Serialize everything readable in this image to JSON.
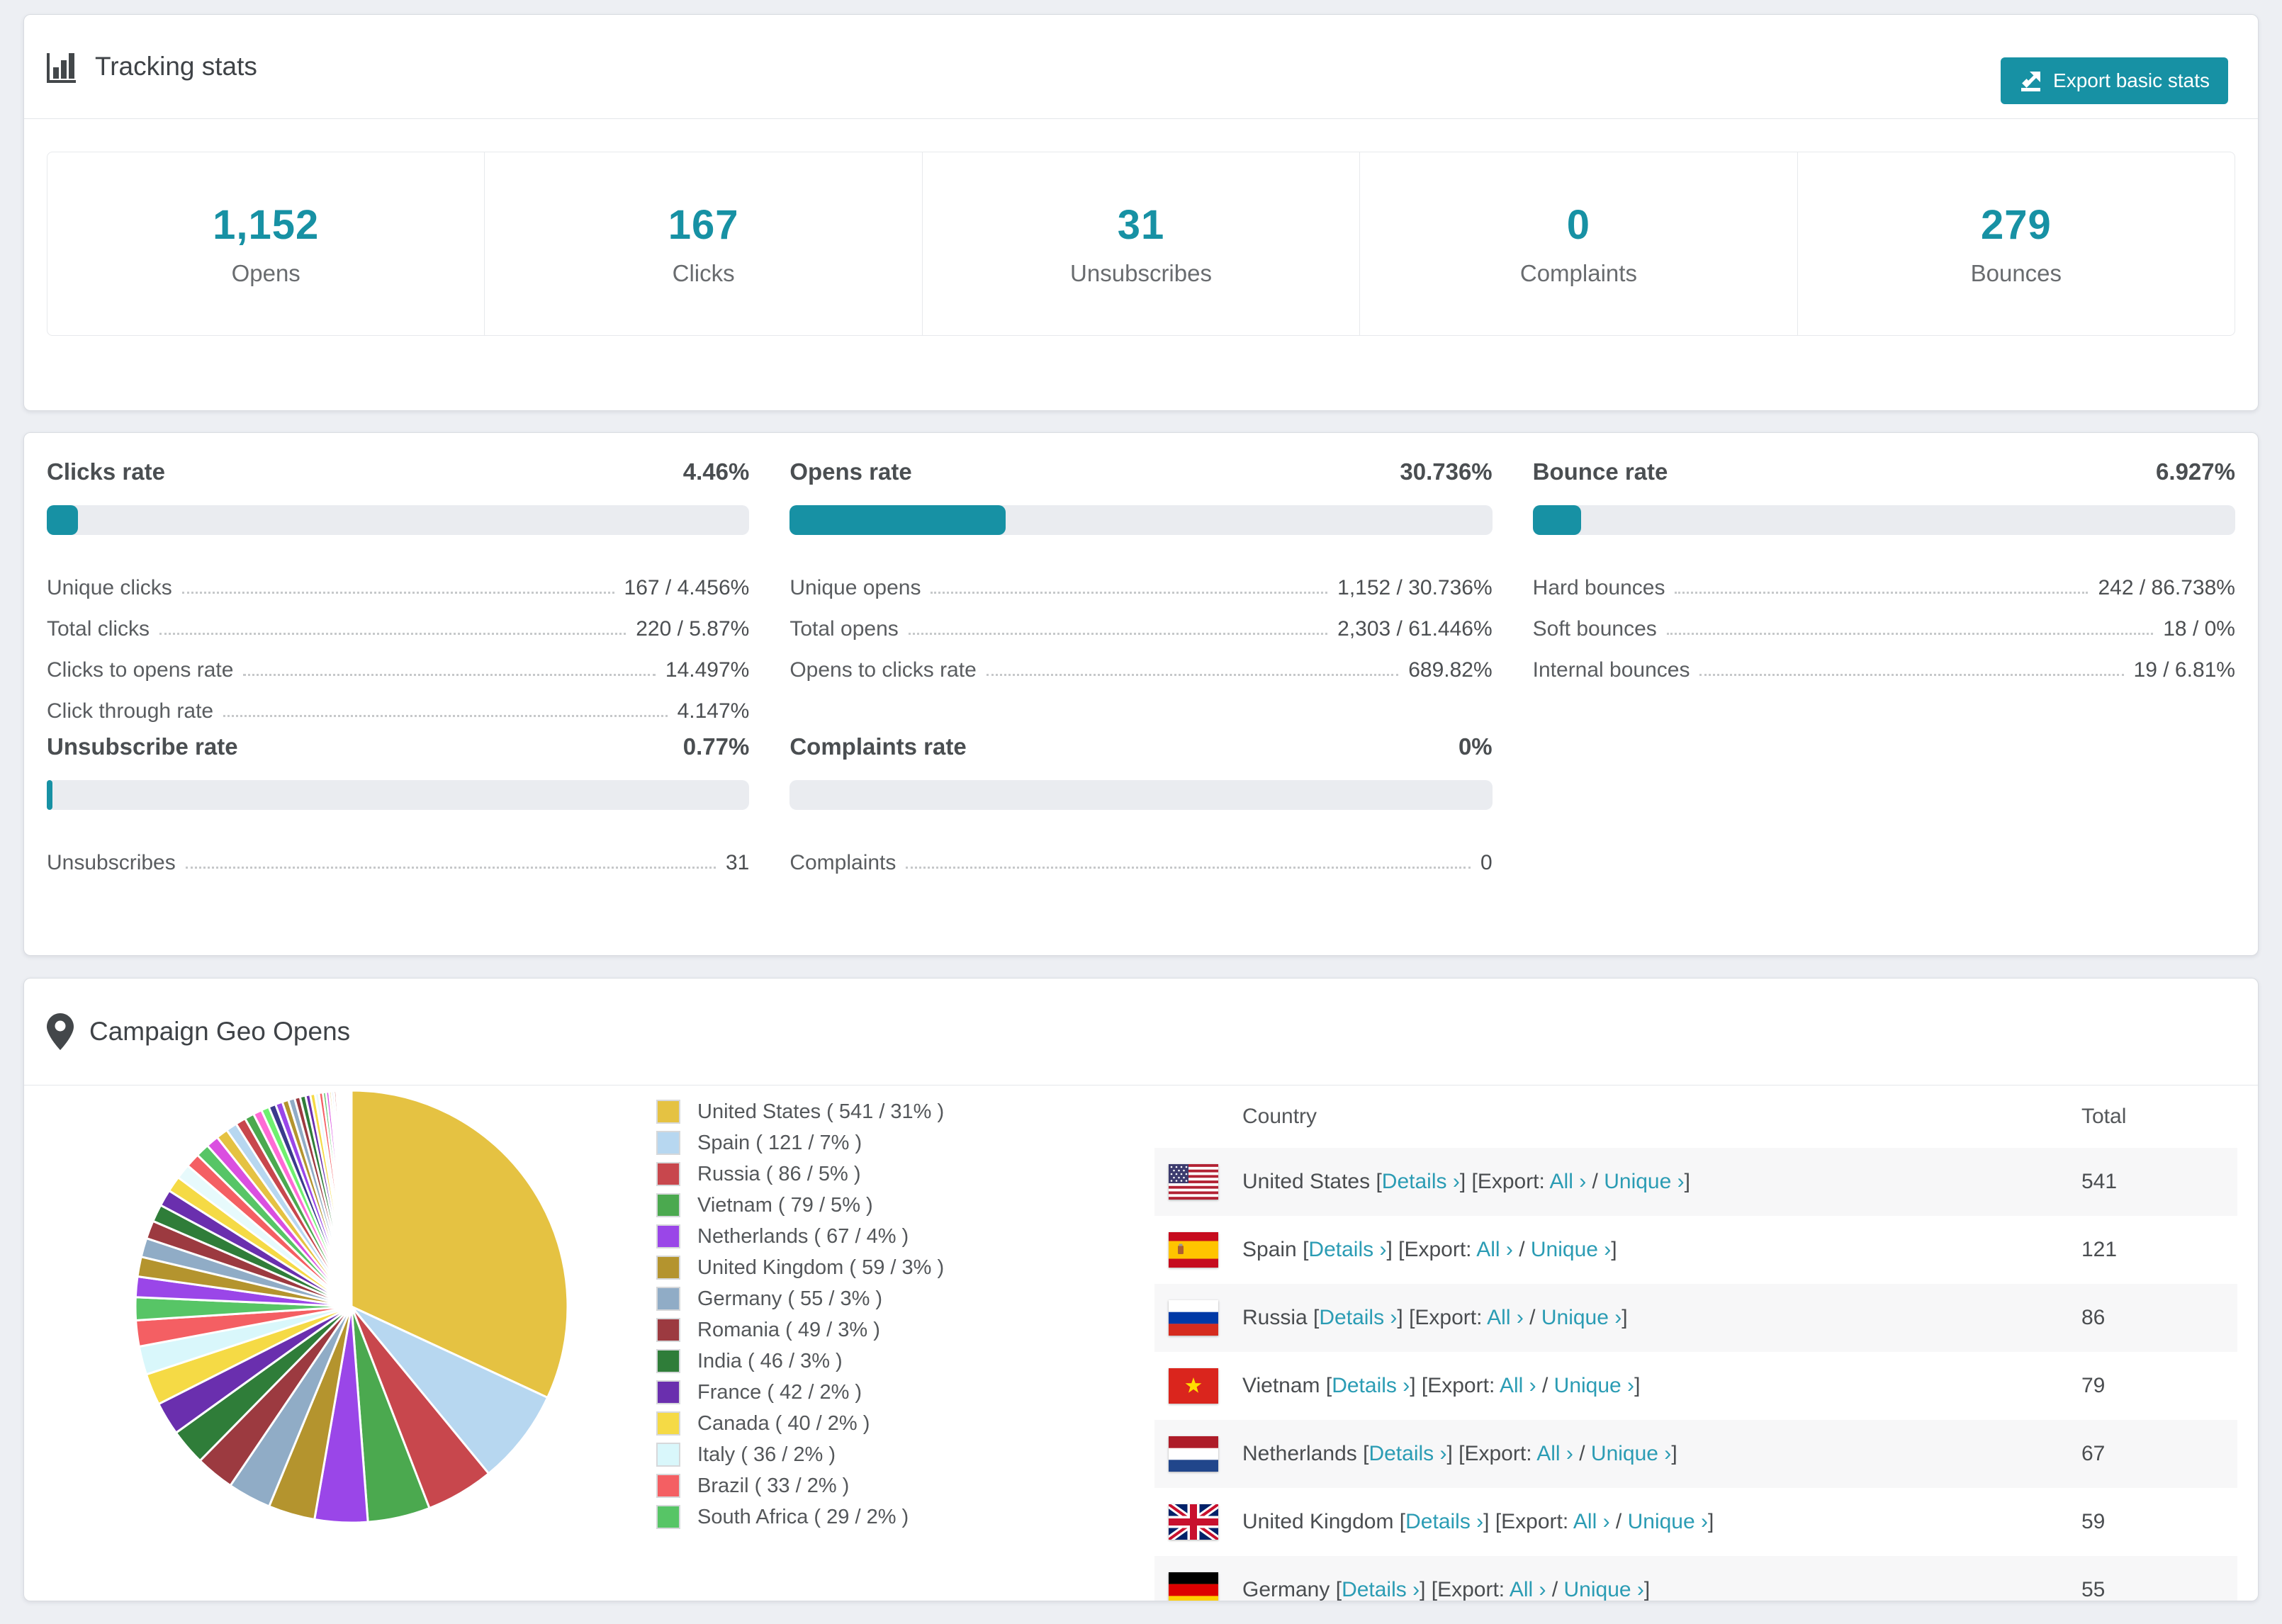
{
  "colors": {
    "accent_teal": "#1791a4",
    "link_teal": "#2b9cb4",
    "page_background": "#edeff3"
  },
  "tracking": {
    "title": "Tracking stats",
    "export_button": "Export basic stats",
    "stats": [
      {
        "value": "1,152",
        "label": "Opens"
      },
      {
        "value": "167",
        "label": "Clicks"
      },
      {
        "value": "31",
        "label": "Unsubscribes"
      },
      {
        "value": "0",
        "label": "Complaints"
      },
      {
        "value": "279",
        "label": "Bounces"
      }
    ]
  },
  "rates": {
    "sections": [
      {
        "id": "clicks",
        "title": "Clicks rate",
        "value": "4.46%",
        "pct": 4.46,
        "rows": [
          {
            "label": "Unique clicks",
            "value": "167 / 4.456%"
          },
          {
            "label": "Total clicks",
            "value": "220 / 5.87%"
          },
          {
            "label": "Clicks to opens rate",
            "value": "14.497%"
          },
          {
            "label": "Click through rate",
            "value": "4.147%"
          }
        ]
      },
      {
        "id": "opens",
        "title": "Opens rate",
        "value": "30.736%",
        "pct": 30.736,
        "rows": [
          {
            "label": "Unique opens",
            "value": "1,152 / 30.736%"
          },
          {
            "label": "Total opens",
            "value": "2,303 / 61.446%"
          },
          {
            "label": "Opens to clicks rate",
            "value": "689.82%"
          }
        ]
      },
      {
        "id": "bounce",
        "title": "Bounce rate",
        "value": "6.927%",
        "pct": 6.927,
        "rows": [
          {
            "label": "Hard bounces",
            "value": "242 / 86.738%"
          },
          {
            "label": "Soft bounces",
            "value": "18 / 0%"
          },
          {
            "label": "Internal bounces",
            "value": "19 / 6.81%"
          }
        ]
      },
      {
        "id": "unsubscribe",
        "title": "Unsubscribe rate",
        "value": "0.77%",
        "pct": 0.77,
        "rows": [
          {
            "label": "Unsubscribes",
            "value": "31"
          }
        ]
      },
      {
        "id": "complaints",
        "title": "Complaints rate",
        "value": "0%",
        "pct": 0,
        "rows": [
          {
            "label": "Complaints",
            "value": "0"
          }
        ]
      }
    ]
  },
  "geo": {
    "title": "Campaign Geo Opens",
    "table": {
      "columns": [
        "Country",
        "Total"
      ],
      "details_open": "[",
      "details_label": "Details ›",
      "details_close": "]",
      "export_prefix": "[Export:",
      "all_label": "All ›",
      "separator": "/",
      "unique_label": "Unique ›",
      "close_bracket": "]",
      "rows": [
        {
          "country": "United States",
          "flag": "us",
          "total": "541"
        },
        {
          "country": "Spain",
          "flag": "es",
          "total": "121"
        },
        {
          "country": "Russia",
          "flag": "ru",
          "total": "86"
        },
        {
          "country": "Vietnam",
          "flag": "vn",
          "total": "79"
        },
        {
          "country": "Netherlands",
          "flag": "nl",
          "total": "67"
        },
        {
          "country": "United Kingdom",
          "flag": "gb",
          "total": "59"
        },
        {
          "country": "Germany",
          "flag": "de",
          "total": "55"
        }
      ]
    },
    "chart_data": {
      "type": "pie",
      "title": "Campaign Geo Opens",
      "legend_position": "right",
      "series": [
        {
          "name": "United States",
          "value": 541,
          "pct": "31%"
        },
        {
          "name": "Spain",
          "value": 121,
          "pct": "7%"
        },
        {
          "name": "Russia",
          "value": 86,
          "pct": "5%"
        },
        {
          "name": "Vietnam",
          "value": 79,
          "pct": "5%"
        },
        {
          "name": "Netherlands",
          "value": 67,
          "pct": "4%"
        },
        {
          "name": "United Kingdom",
          "value": 59,
          "pct": "3%"
        },
        {
          "name": "Germany",
          "value": 55,
          "pct": "3%"
        },
        {
          "name": "Romania",
          "value": 49,
          "pct": "3%"
        },
        {
          "name": "India",
          "value": 46,
          "pct": "3%"
        },
        {
          "name": "France",
          "value": 42,
          "pct": "2%"
        },
        {
          "name": "Canada",
          "value": 40,
          "pct": "2%"
        },
        {
          "name": "Italy",
          "value": 36,
          "pct": "2%"
        },
        {
          "name": "Brazil",
          "value": 33,
          "pct": "2%"
        },
        {
          "name": "South Africa",
          "value": 29,
          "pct": "2%"
        }
      ],
      "others_estimated_values": [
        26,
        25,
        24,
        23,
        22,
        21,
        20,
        19,
        18,
        17,
        16,
        15,
        14,
        13,
        12,
        11,
        10,
        9,
        9,
        8,
        8,
        7,
        7,
        6,
        6,
        5,
        5,
        4,
        4,
        3,
        3,
        3,
        2,
        2,
        2,
        2,
        2,
        1,
        1,
        1,
        1,
        1,
        1,
        1,
        1,
        1
      ],
      "palette": [
        "#e5c242",
        "#b7d7f0",
        "#c8474d",
        "#4ba94f",
        "#9a46e8",
        "#b4942e",
        "#90acc6",
        "#9c3a40",
        "#2f7d39",
        "#6a2fae",
        "#f5da45",
        "#d9f7fb",
        "#f45f63",
        "#57c566"
      ],
      "others_palette": [
        "#9a46e8",
        "#b4942e",
        "#90acc6",
        "#9c3a40",
        "#2f7d39",
        "#6a2fae",
        "#f5da45",
        "#e7fafc",
        "#f45f63",
        "#57c566",
        "#da4fe0",
        "#e5c242",
        "#b7d7f0",
        "#c8474d",
        "#4ba94f",
        "#ff6ad5",
        "#6ff06f",
        "#3a3a8c"
      ]
    }
  }
}
